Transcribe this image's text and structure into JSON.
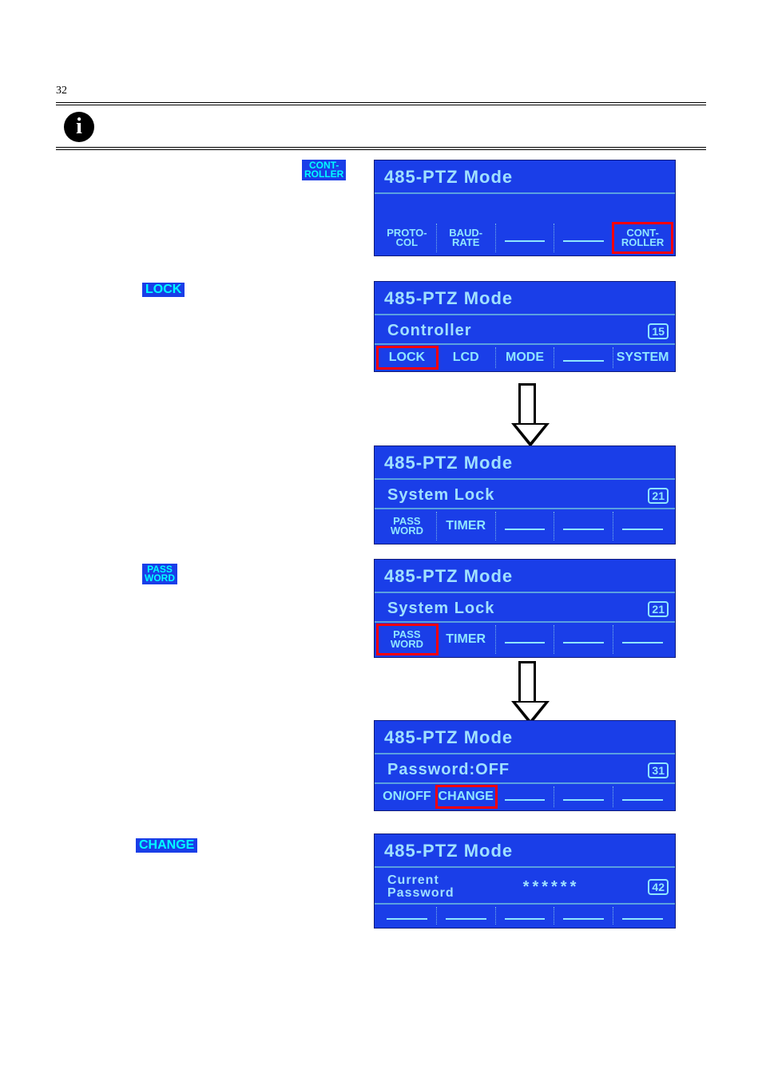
{
  "page_number": "32",
  "top_icon": "i",
  "left_chips": {
    "controller": {
      "line1": "CONT-",
      "line2": "ROLLER"
    },
    "lock": "LOCK",
    "password": {
      "line1": "PASS",
      "line2": "WORD"
    },
    "change": "CHANGE"
  },
  "lcd_title": "485-PTZ Mode",
  "panels": {
    "p1": {
      "keys": [
        {
          "type": "two",
          "l1": "PROTO-",
          "l2": "COL"
        },
        {
          "type": "two",
          "l1": "BAUD-",
          "l2": "RATE"
        },
        {
          "type": "dash"
        },
        {
          "type": "dash"
        },
        {
          "type": "two",
          "l1": "CONT-",
          "l2": "ROLLER",
          "hl": true
        }
      ]
    },
    "p2": {
      "sub": {
        "text": "Controller",
        "num": "15"
      },
      "keys": [
        {
          "type": "one",
          "t": "LOCK",
          "hl": true
        },
        {
          "type": "one",
          "t": "LCD"
        },
        {
          "type": "one",
          "t": "MODE"
        },
        {
          "type": "dash"
        },
        {
          "type": "one",
          "t": "SYSTEM"
        }
      ]
    },
    "p3": {
      "sub": {
        "text": "System Lock",
        "num": "21"
      },
      "keys": [
        {
          "type": "two",
          "l1": "PASS",
          "l2": "WORD"
        },
        {
          "type": "one",
          "t": "TIMER"
        },
        {
          "type": "dash"
        },
        {
          "type": "dash"
        },
        {
          "type": "dash"
        }
      ]
    },
    "p4": {
      "sub": {
        "text": "System Lock",
        "num": "21"
      },
      "keys": [
        {
          "type": "two",
          "l1": "PASS",
          "l2": "WORD",
          "hl": true
        },
        {
          "type": "one",
          "t": "TIMER"
        },
        {
          "type": "dash"
        },
        {
          "type": "dash"
        },
        {
          "type": "dash"
        }
      ]
    },
    "p5": {
      "sub": {
        "text": "Password:OFF",
        "num": "31"
      },
      "keys": [
        {
          "type": "one",
          "t": "ON/OFF"
        },
        {
          "type": "one",
          "t": "CHANGE",
          "hl": true
        },
        {
          "type": "dash"
        },
        {
          "type": "dash"
        },
        {
          "type": "dash"
        }
      ]
    },
    "p6": {
      "sub": {
        "text_l1": "Current",
        "text_l2": "Password",
        "extra": "******",
        "num": "42"
      },
      "keys": [
        {
          "type": "dash"
        },
        {
          "type": "dash"
        },
        {
          "type": "dash"
        },
        {
          "type": "dash"
        },
        {
          "type": "dash"
        }
      ]
    }
  }
}
